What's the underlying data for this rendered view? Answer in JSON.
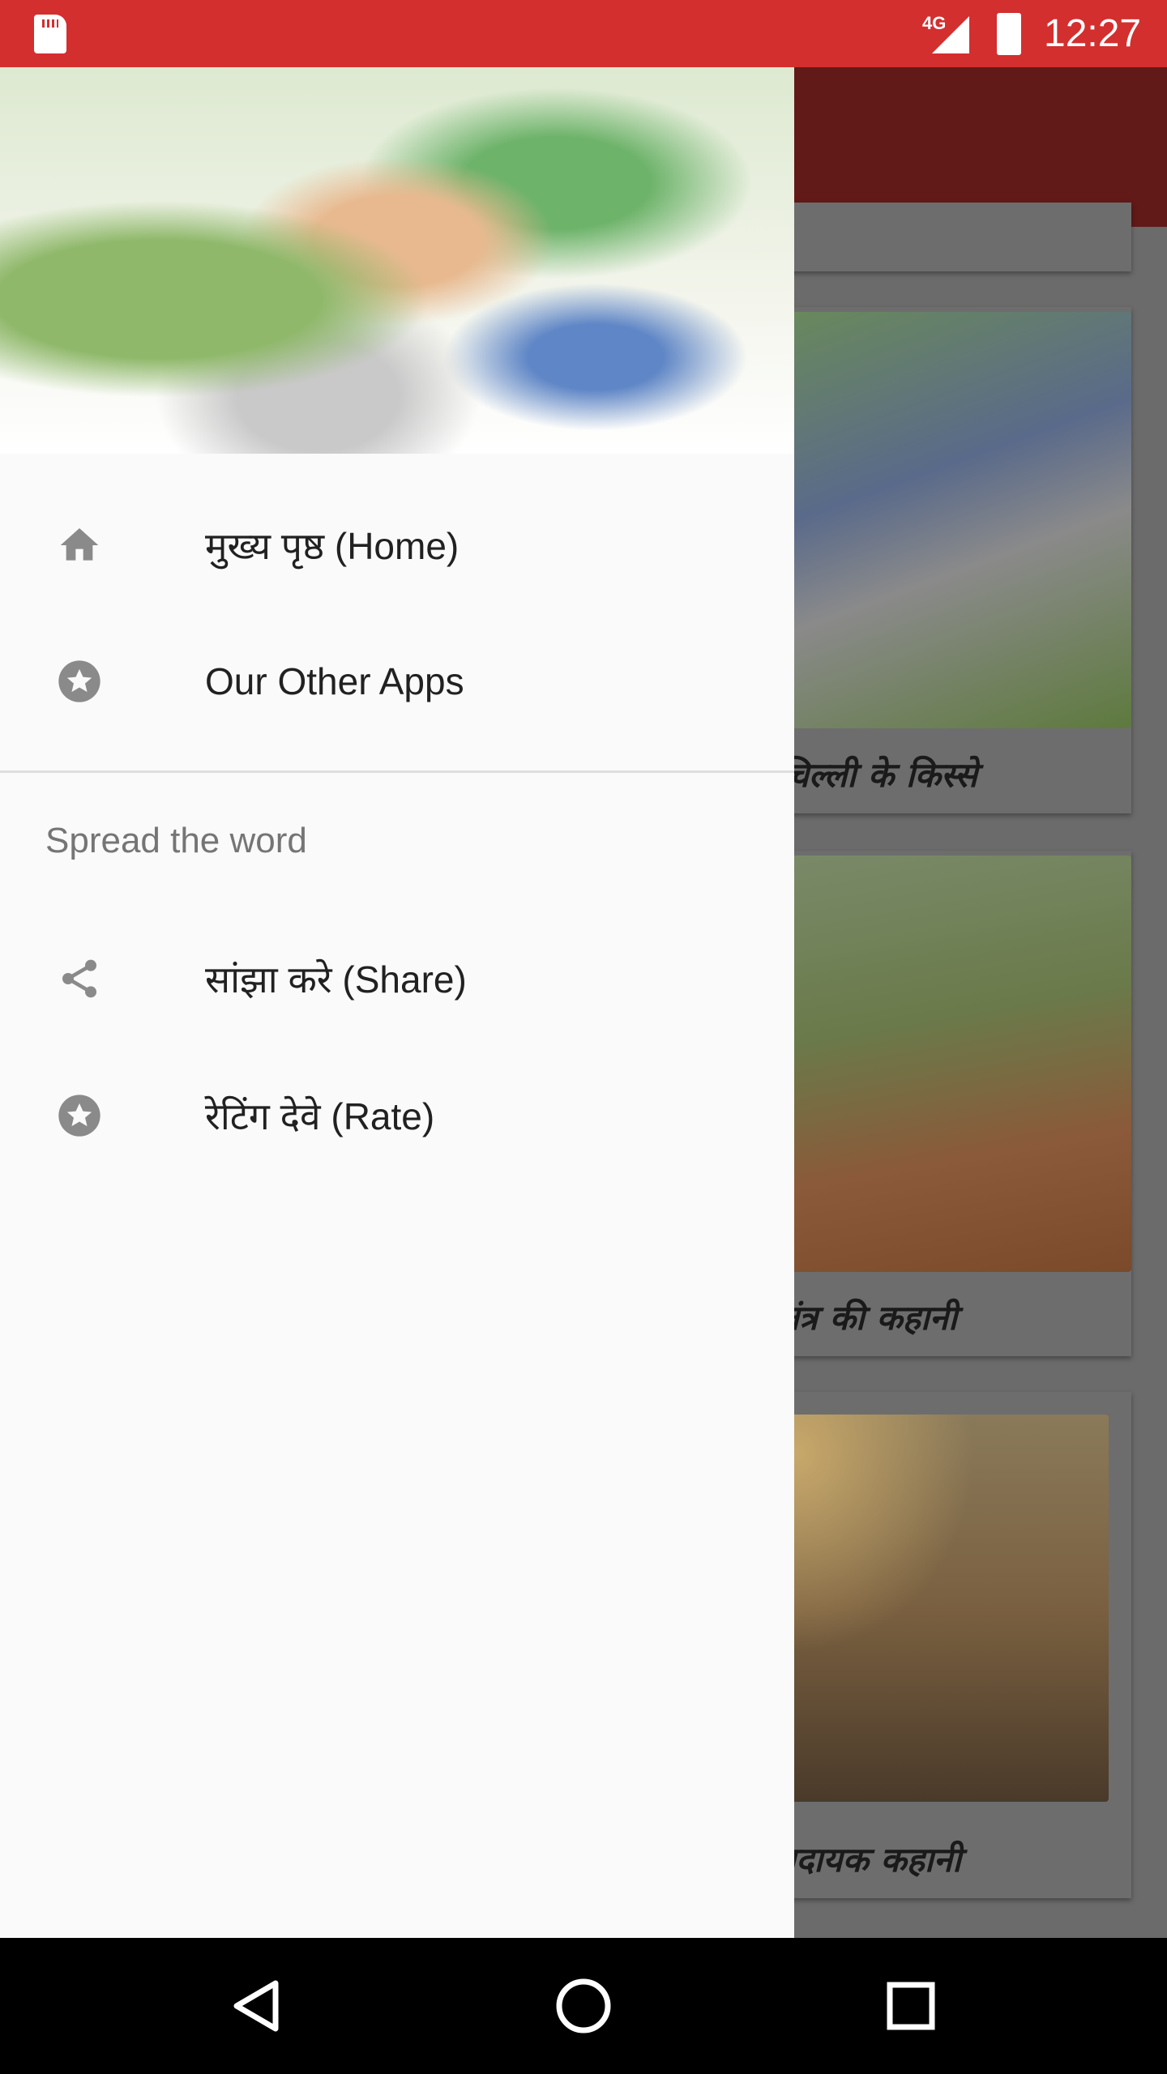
{
  "status_bar": {
    "network": "4G",
    "time": "12:27",
    "color": "#d32f2f"
  },
  "app_bar": {
    "color": "#611a17"
  },
  "background_cards": [
    {
      "title": "चिल्ली के किस्से",
      "image": "man-with-bull-illustration"
    },
    {
      "title": "तंत्र की कहानी",
      "image": "animals-and-sages-illustration"
    },
    {
      "title": "ादायक कहानी",
      "image": "sunset-silhouette-photo"
    }
  ],
  "drawer": {
    "header_image": "cartoon-characters-banner",
    "items": [
      {
        "label": "मुख्य पृष्ठ (Home)",
        "icon": "home-icon"
      },
      {
        "label": "Our Other Apps",
        "icon": "star-circle-icon"
      }
    ],
    "section_title": "Spread the word",
    "section_items": [
      {
        "label": "सांझा करे (Share)",
        "icon": "share-icon"
      },
      {
        "label": "रेटिंग देवे (Rate)",
        "icon": "star-circle-icon"
      }
    ]
  },
  "nav_bar": {
    "back": "back-icon",
    "home": "home-circle-icon",
    "recents": "recents-icon"
  }
}
